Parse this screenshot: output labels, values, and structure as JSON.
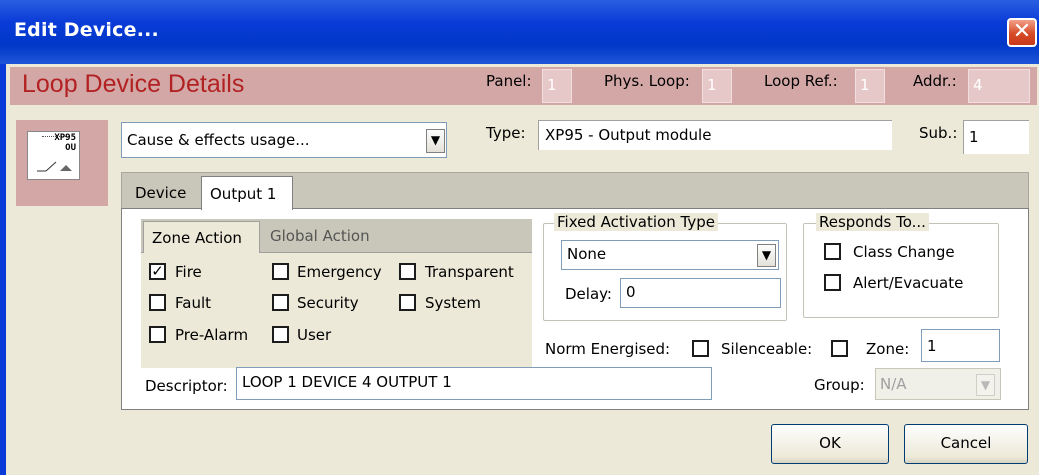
{
  "window": {
    "title": "Edit Device...",
    "close_glyph": "✕"
  },
  "header": {
    "title": "Loop Device Details",
    "panel_label": "Panel:",
    "panel_value": "1",
    "phys_loop_label": "Phys. Loop:",
    "phys_loop_value": "1",
    "loop_ref_label": "Loop Ref.:",
    "loop_ref_value": "1",
    "addr_label": "Addr.:",
    "addr_value": "4"
  },
  "device_icon": {
    "icon": "xp95-output-module-icon",
    "line1": "XP95",
    "line2": "OU"
  },
  "usage_dropdown": {
    "value": "Cause & effects usage..."
  },
  "type": {
    "label": "Type:",
    "value": "XP95 - Output module"
  },
  "sub": {
    "label": "Sub.:",
    "value": "1"
  },
  "tabs": [
    {
      "label": "Device",
      "active": false
    },
    {
      "label": "Output 1",
      "active": true
    }
  ],
  "zone_tabs": [
    {
      "label": "Zone Action",
      "active": true
    },
    {
      "label": "Global Action",
      "active": false
    }
  ],
  "zone_checkboxes": [
    {
      "label": "Fire",
      "checked": true
    },
    {
      "label": "Emergency",
      "checked": false
    },
    {
      "label": "Transparent",
      "checked": false
    },
    {
      "label": "Fault",
      "checked": false
    },
    {
      "label": "Security",
      "checked": false
    },
    {
      "label": "System",
      "checked": false
    },
    {
      "label": "Pre-Alarm",
      "checked": false
    },
    {
      "label": "User",
      "checked": false
    }
  ],
  "fixed_activation": {
    "title": "Fixed Activation Type",
    "value": "None",
    "delay_label": "Delay:",
    "delay_value": "0"
  },
  "responds_to": {
    "title": "Responds To...",
    "options": [
      {
        "label": "Class Change",
        "checked": false
      },
      {
        "label": "Alert/Evacuate",
        "checked": false
      }
    ]
  },
  "norm_energised": {
    "label": "Norm Energised:",
    "checked": false
  },
  "silenceable": {
    "label": "Silenceable:",
    "checked": false
  },
  "zone": {
    "label": "Zone:",
    "value": "1"
  },
  "descriptor": {
    "label": "Descriptor:",
    "value": "LOOP 1 DEVICE 4 OUTPUT 1"
  },
  "group": {
    "label": "Group:",
    "value": "N/A"
  },
  "buttons": {
    "ok": "OK",
    "cancel": "Cancel"
  },
  "dropdown_arrow": "▼",
  "colors": {
    "header_band": "#d4a7a7",
    "header_title": "#b22222",
    "titlebar": "#0a3bd8",
    "dialog_bg": "#ece9d8"
  }
}
